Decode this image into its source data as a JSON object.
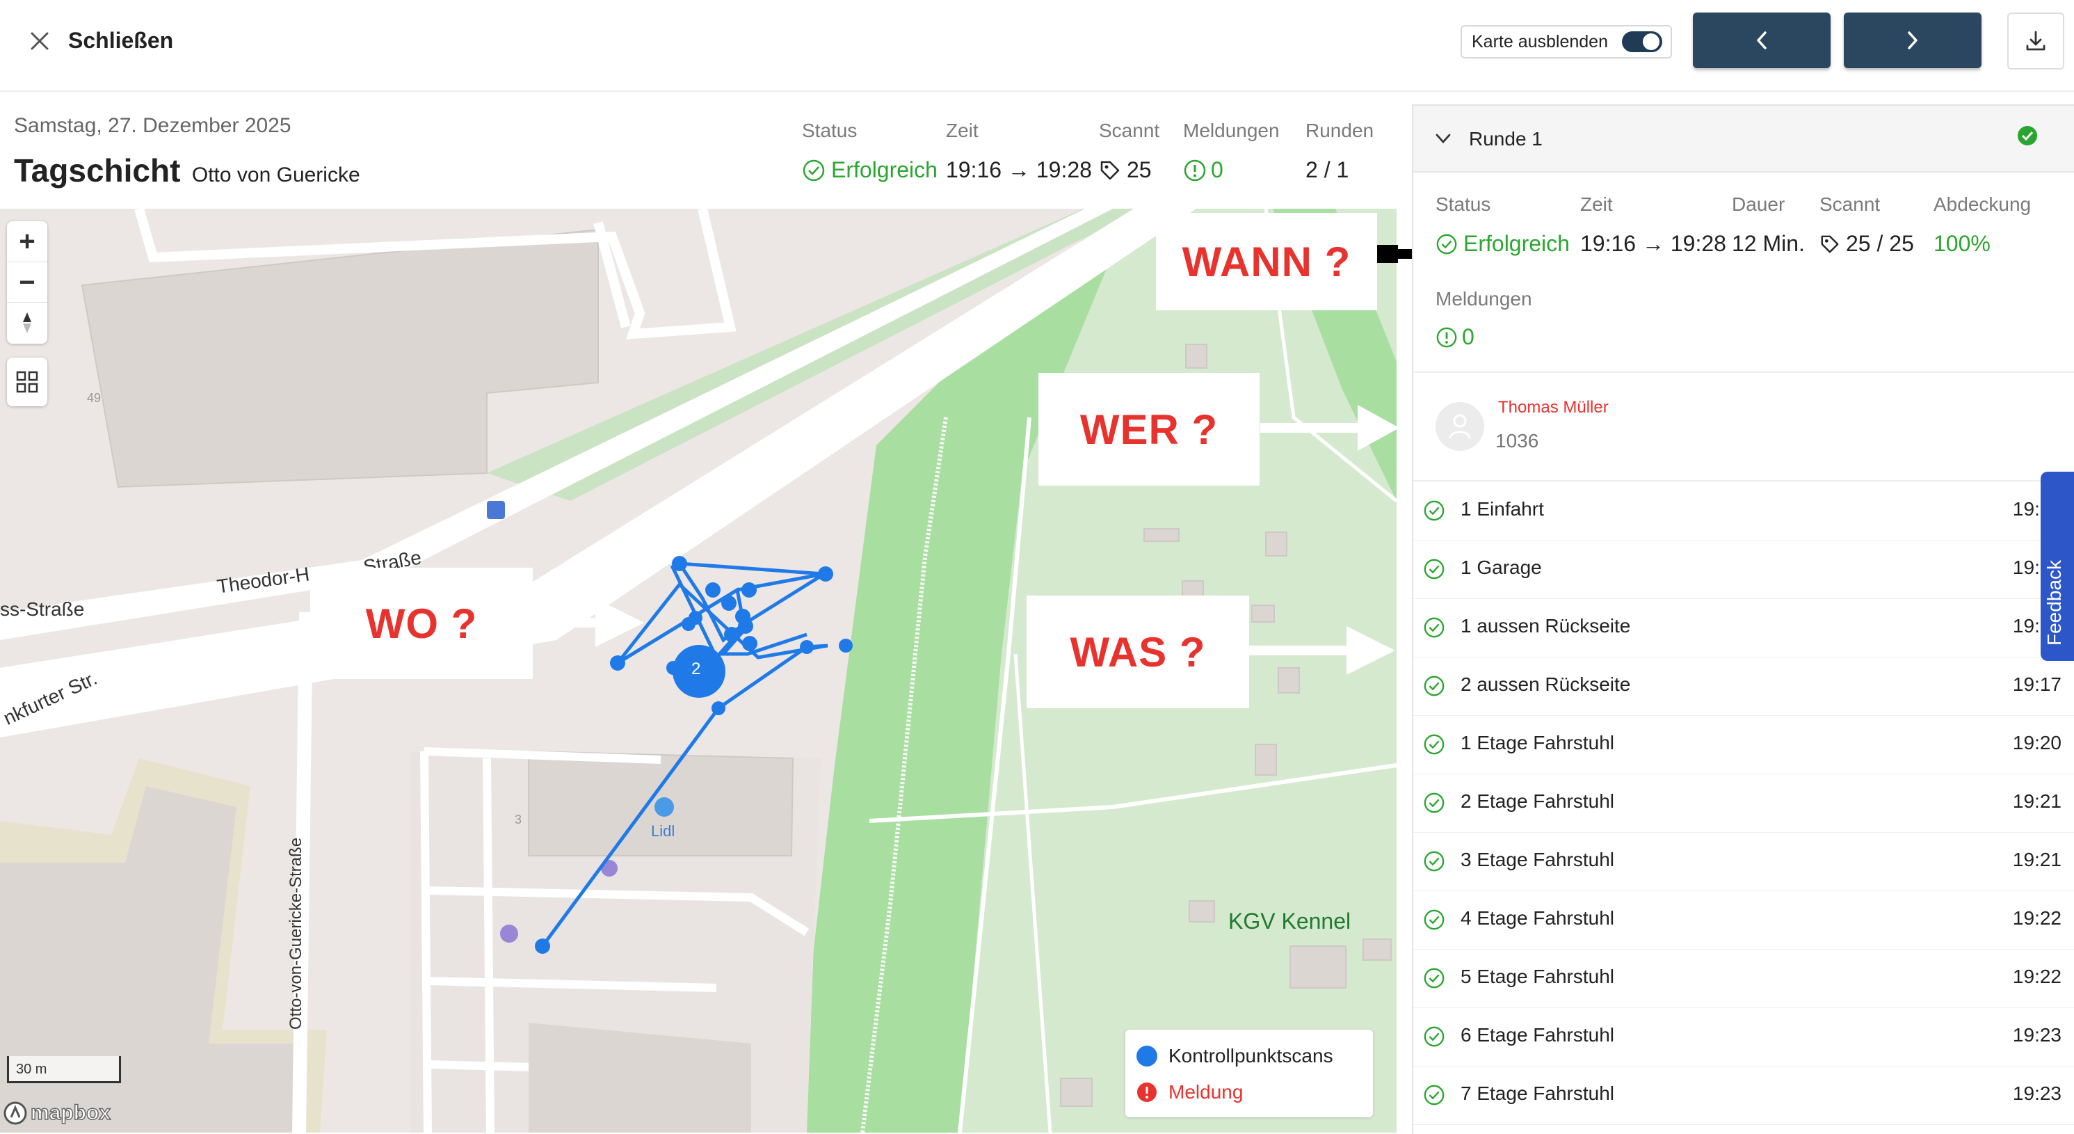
{
  "topbar": {
    "close_label": "Schließen",
    "hide_map_label": "Karte ausblenden",
    "hide_map_on": true
  },
  "shift": {
    "date": "Samstag, 27. Dezember 2025",
    "title": "Tagschicht",
    "location": "Otto von Guericke",
    "status_label": "Status",
    "status_value": "Erfolgreich",
    "time_label": "Zeit",
    "time_value": "19:16 → 19:28",
    "scans_label": "Scannt",
    "scans_value": "25",
    "reports_label": "Meldungen",
    "reports_value": "0",
    "rounds_label": "Runden",
    "rounds_value": "2 / 1"
  },
  "map": {
    "streets": [
      "Theodor-H",
      "Straße",
      "ss-Straße",
      "nkfurter Str.",
      "Otto-von-Guericke-Straße"
    ],
    "poi_lidl": "Lidl",
    "house_number_49": "49",
    "house_number_3": "3",
    "park_label": "KGV Kennel",
    "cluster_count": "2",
    "scale_label": "30 m",
    "attribution": "mapbox",
    "legend": [
      {
        "label": "Kontrollpunktscans",
        "color": "#1f7ae8"
      },
      {
        "label": "Meldung",
        "color": "#e8322d"
      }
    ]
  },
  "annotations": {
    "wann": "WANN ?",
    "wer": "WER ?",
    "wo": "WO ?",
    "was": "WAS ?"
  },
  "round": {
    "title": "Runde 1",
    "status_label": "Status",
    "status_value": "Erfolgreich",
    "time_label": "Zeit",
    "time_value": "19:16 → 19:28",
    "duration_label": "Dauer",
    "duration_value": "12 Min.",
    "scans_label": "Scannt",
    "scans_value": "25 / 25",
    "coverage_label": "Abdeckung",
    "coverage_value": "100%",
    "reports_label": "Meldungen",
    "reports_value": "0",
    "guard_name": "Thomas Müller",
    "guard_id": "1036",
    "checkpoints": [
      {
        "name": "1 Einfahrt",
        "time": "19:16"
      },
      {
        "name": "1 Garage",
        "time": "19:16"
      },
      {
        "name": "1 aussen Rückseite",
        "time": "19:17"
      },
      {
        "name": "2 aussen Rückseite",
        "time": "19:17"
      },
      {
        "name": "1 Etage Fahrstuhl",
        "time": "19:20"
      },
      {
        "name": "2 Etage Fahrstuhl",
        "time": "19:21"
      },
      {
        "name": "3 Etage Fahrstuhl",
        "time": "19:21"
      },
      {
        "name": "4 Etage Fahrstuhl",
        "time": "19:22"
      },
      {
        "name": "5 Etage Fahrstuhl",
        "time": "19:22"
      },
      {
        "name": "6 Etage Fahrstuhl",
        "time": "19:23"
      },
      {
        "name": "7 Etage Fahrstuhl",
        "time": "19:23"
      }
    ]
  },
  "feedback_label": "Feedback"
}
